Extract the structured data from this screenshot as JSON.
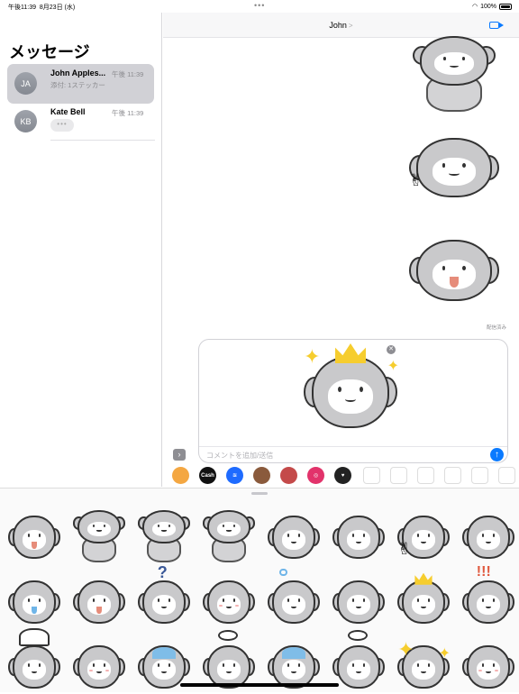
{
  "status_bar": {
    "time": "午後11:39",
    "date": "8月23日 (水)",
    "dots": "•••",
    "battery": "100%"
  },
  "sidebar": {
    "title": "メッセージ",
    "conversations": [
      {
        "initials": "JA",
        "name": "John Apples...",
        "time": "午後 11:39",
        "preview": "添付: 1ステッカー",
        "selected": true
      },
      {
        "initials": "KB",
        "name": "Kate Bell",
        "time": "午後 11:39",
        "preview": "•••",
        "selected": false
      }
    ]
  },
  "chat": {
    "contact_name": "John",
    "chevron": ">",
    "delivered": "配信済み",
    "compose_placeholder": "コメントを追加/送信",
    "close_glyph": "✕",
    "send_glyph": "↑",
    "expand_glyph": "›"
  },
  "app_drawer": {
    "apps": [
      {
        "name": "photos-app-icon",
        "label": "",
        "color": "#f4a742"
      },
      {
        "name": "apple-cash-icon",
        "label": "Cash",
        "color": "#111111"
      },
      {
        "name": "audio-message-icon",
        "label": "≋",
        "color": "#1e6bff"
      },
      {
        "name": "memoji-icon",
        "label": "",
        "color": "#8a5a3c"
      },
      {
        "name": "game-app-icon",
        "label": "",
        "color": "#c44a4a"
      },
      {
        "name": "search-images-icon",
        "label": "◎",
        "color": "#e2336b"
      },
      {
        "name": "digital-touch-icon",
        "label": "♥",
        "color": "#222222"
      }
    ]
  },
  "stickers": {
    "panel_rows": 3,
    "panel_cols": 8,
    "variants": [
      "tongue",
      "arms",
      "excited",
      "lying",
      "smile",
      "wink",
      "peace",
      "dizzy",
      "drool",
      "tongue",
      "question",
      "cheeks",
      "fish",
      "lines",
      "crown",
      "exclaim",
      "chef",
      "sweat",
      "cry",
      "steam",
      "blue",
      "think",
      "sparkle",
      "hearts"
    ]
  }
}
